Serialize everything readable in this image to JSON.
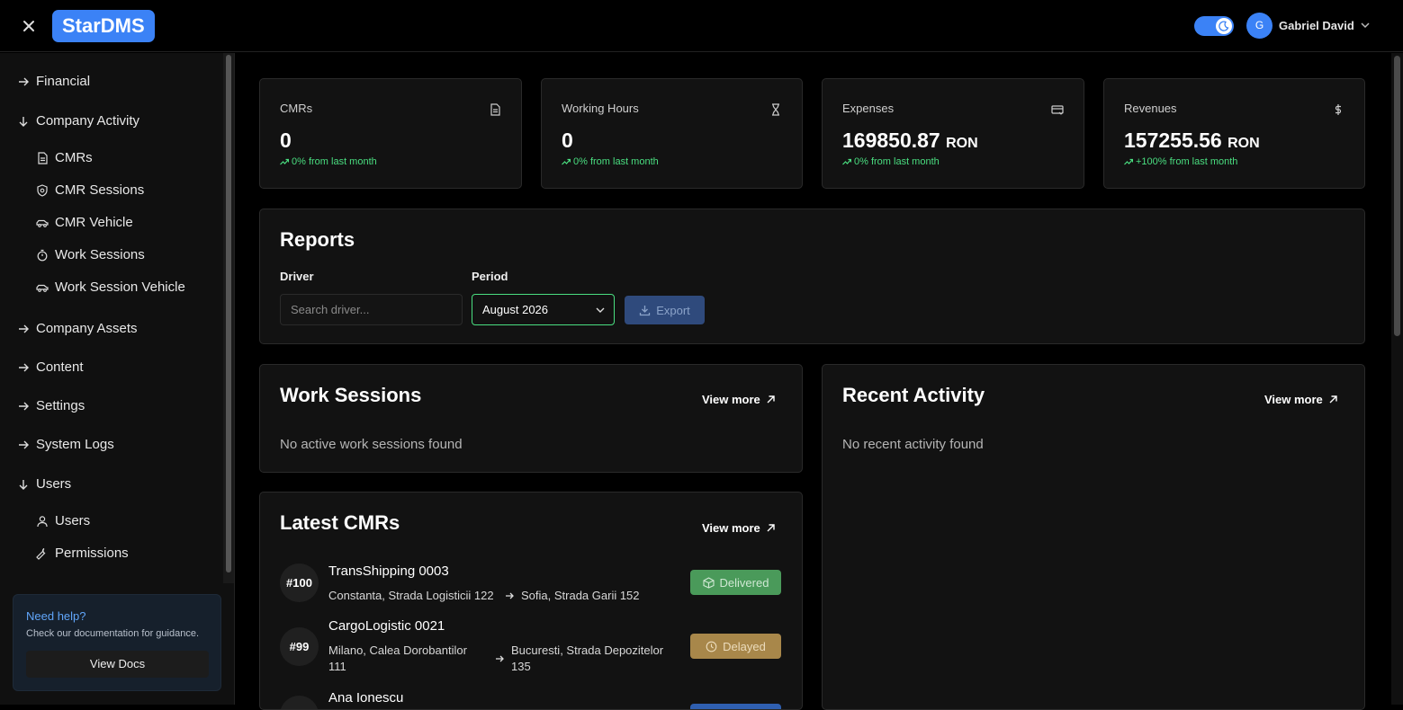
{
  "app": {
    "logo": "StarDMS"
  },
  "header": {
    "user_initial": "G",
    "user_name": "Gabriel David"
  },
  "sidebar": {
    "items": [
      {
        "label": "Financial",
        "state": "collapsed"
      },
      {
        "label": "Company Activity",
        "state": "expanded",
        "children": [
          "CMRs",
          "CMR Sessions",
          "CMR Vehicle",
          "Work Sessions",
          "Work Session Vehicle"
        ]
      },
      {
        "label": "Company Assets",
        "state": "collapsed"
      },
      {
        "label": "Content",
        "state": "collapsed"
      },
      {
        "label": "Settings",
        "state": "collapsed"
      },
      {
        "label": "System Logs",
        "state": "collapsed"
      },
      {
        "label": "Users",
        "state": "expanded",
        "children": [
          "Users",
          "Permissions"
        ]
      }
    ],
    "help": {
      "title": "Need help?",
      "text": "Check our documentation for guidance.",
      "button": "View Docs"
    }
  },
  "stats": [
    {
      "label": "CMRs",
      "value": "0",
      "unit": "",
      "trend": "0% from last month",
      "icon": "document-icon"
    },
    {
      "label": "Working Hours",
      "value": "0",
      "unit": "",
      "trend": "0% from last month",
      "icon": "hourglass-icon"
    },
    {
      "label": "Expenses",
      "value": "169850.87",
      "unit": "RON",
      "trend": "0% from last month",
      "icon": "card-icon"
    },
    {
      "label": "Revenues",
      "value": "157255.56",
      "unit": "RON",
      "trend": "+100% from last month",
      "icon": "dollar-icon"
    }
  ],
  "reports": {
    "title": "Reports",
    "driver_label": "Driver",
    "driver_placeholder": "Search driver...",
    "period_label": "Period",
    "period_value": "August 2026",
    "export_label": "Export"
  },
  "work_sessions": {
    "title": "Work Sessions",
    "view_more": "View more",
    "empty": "No active work sessions found"
  },
  "recent_activity": {
    "title": "Recent Activity",
    "view_more": "View more",
    "empty": "No recent activity found"
  },
  "latest_cmrs": {
    "title": "Latest CMRs",
    "view_more": "View more",
    "rows": [
      {
        "id": "#100",
        "name": "TransShipping 0003",
        "from": "Constanta, Strada Logisticii 122",
        "to": "Sofia, Strada Garii 152",
        "status": "Delivered",
        "status_color": "#4a9a5a"
      },
      {
        "id": "#99",
        "name": "CargoLogistic 0021",
        "from": "Milano, Calea Dorobantilor 111",
        "to": "Bucuresti, Strada Depozitelor 135",
        "status": "Delayed",
        "status_color": "#a8874a"
      },
      {
        "id": "",
        "name": "Ana Ionescu",
        "from": "",
        "to": "",
        "status": "",
        "status_color": "#2f5fb0"
      }
    ]
  },
  "colors": {
    "accent": "#3b82f6",
    "success": "#4ade80",
    "background": "#000000",
    "card": "#121212"
  }
}
